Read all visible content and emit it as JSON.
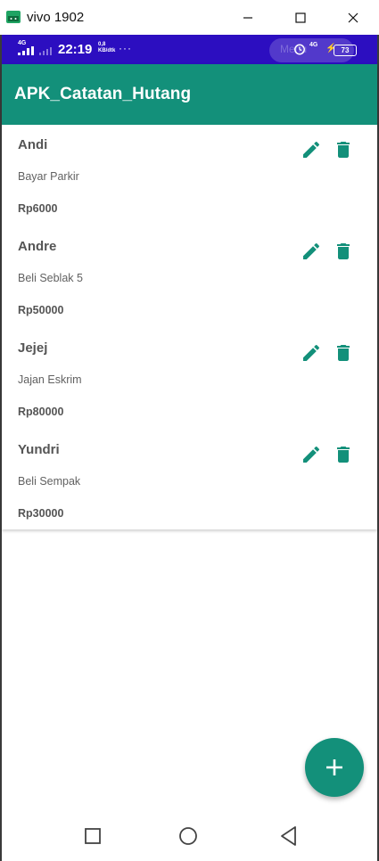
{
  "window": {
    "title": "vivo 1902"
  },
  "status_bar": {
    "network_left": "4G",
    "time": "22:19",
    "speed_value": "0,8",
    "speed_unit": "KB/dtk",
    "more": "···",
    "pill_text": "Menu",
    "network_right": "4G",
    "battery": "73"
  },
  "app_bar": {
    "title": "APK_Catatan_Hutang"
  },
  "items": [
    {
      "name": "Andi",
      "description": "Bayar Parkir",
      "amount": "Rp6000"
    },
    {
      "name": "Andre",
      "description": "Beli Seblak 5",
      "amount": "Rp50000"
    },
    {
      "name": "Jejej",
      "description": "Jajan Eskrim",
      "amount": "Rp80000"
    },
    {
      "name": "Yundri",
      "description": "Beli Sempak",
      "amount": "Rp30000"
    }
  ],
  "colors": {
    "primary": "#13907a",
    "status_bar": "#2c0ec0"
  },
  "icons": {
    "edit": "pencil-icon",
    "delete": "trash-icon",
    "fab": "plus-icon",
    "nav": [
      "recents-square-icon",
      "home-circle-icon",
      "back-triangle-icon"
    ]
  }
}
